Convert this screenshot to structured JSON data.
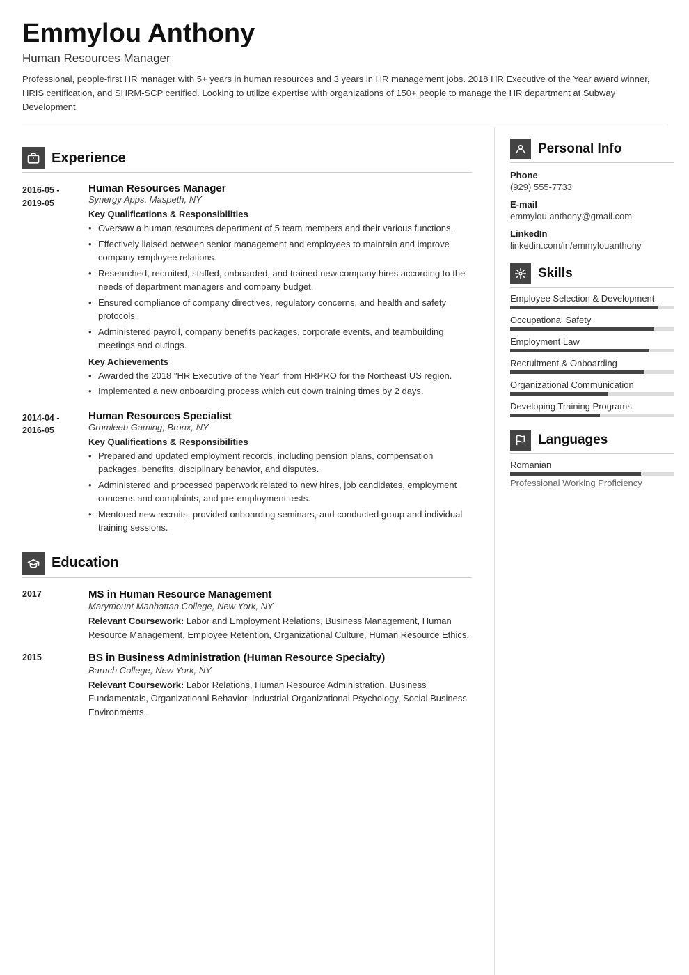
{
  "header": {
    "name": "Emmylou Anthony",
    "title": "Human Resources Manager",
    "summary": "Professional, people-first HR manager with 5+ years in human resources and 3 years in HR management jobs. 2018 HR Executive of the Year award winner, HRIS certification, and SHRM-SCP certified. Looking to utilize expertise with organizations of 150+ people to manage the HR department at Subway Development."
  },
  "sections": {
    "experience": {
      "title": "Experience",
      "entries": [
        {
          "date_start": "2016-05 -",
          "date_end": "2019-05",
          "job_title": "Human Resources Manager",
          "company": "Synergy Apps, Maspeth, NY",
          "subsections": [
            {
              "title": "Key Qualifications & Responsibilities",
              "bullets": [
                "Oversaw a human resources department of 5 team members and their various functions.",
                "Effectively liaised between senior management and employees to maintain and improve company-employee relations.",
                "Researched, recruited, staffed, onboarded, and trained new company hires according to the needs of department managers and company budget.",
                "Ensured compliance of company directives, regulatory concerns, and health and safety protocols.",
                "Administered payroll, company benefits packages, corporate events, and teambuilding meetings and outings."
              ]
            },
            {
              "title": "Key Achievements",
              "bullets": [
                "Awarded the 2018 \"HR Executive of the Year\" from HRPRO for the Northeast US region.",
                "Implemented a new onboarding process which cut down training times by 2 days."
              ]
            }
          ]
        },
        {
          "date_start": "2014-04 -",
          "date_end": "2016-05",
          "job_title": "Human Resources Specialist",
          "company": "Gromleeb Gaming, Bronx, NY",
          "subsections": [
            {
              "title": "Key Qualifications & Responsibilities",
              "bullets": [
                "Prepared and updated employment records, including pension plans, compensation packages, benefits, disciplinary behavior, and disputes.",
                "Administered and processed paperwork related to new hires, job candidates, employment concerns and complaints, and pre-employment tests.",
                "Mentored new recruits, provided onboarding seminars, and conducted group and individual training sessions."
              ]
            }
          ]
        }
      ]
    },
    "education": {
      "title": "Education",
      "entries": [
        {
          "year": "2017",
          "degree": "MS in Human Resource Management",
          "school": "Marymount Manhattan College, New York, NY",
          "coursework": "Labor and Employment Relations, Business Management, Human Resource Management, Employee Retention, Organizational Culture, Human Resource Ethics."
        },
        {
          "year": "2015",
          "degree": "BS in Business Administration (Human Resource Specialty)",
          "school": "Baruch College, New York, NY",
          "coursework": "Labor Relations, Human Resource Administration, Business Fundamentals, Organizational Behavior, Industrial-Organizational Psychology, Social Business Environments."
        }
      ]
    }
  },
  "sidebar": {
    "personal_info": {
      "title": "Personal Info",
      "phone_label": "Phone",
      "phone": "(929) 555-7733",
      "email_label": "E-mail",
      "email": "emmylou.anthony@gmail.com",
      "linkedin_label": "LinkedIn",
      "linkedin": "linkedin.com/in/emmylouanthony"
    },
    "skills": {
      "title": "Skills",
      "items": [
        {
          "name": "Employee Selection & Development",
          "percent": 90
        },
        {
          "name": "Occupational Safety",
          "percent": 88
        },
        {
          "name": "Employment Law",
          "percent": 85
        },
        {
          "name": "Recruitment & Onboarding",
          "percent": 82
        },
        {
          "name": "Organizational Communication",
          "percent": 60
        },
        {
          "name": "Developing Training Programs",
          "percent": 55
        }
      ]
    },
    "languages": {
      "title": "Languages",
      "items": [
        {
          "name": "Romanian",
          "bar_percent": 80,
          "level": "Professional Working Proficiency"
        }
      ]
    }
  }
}
